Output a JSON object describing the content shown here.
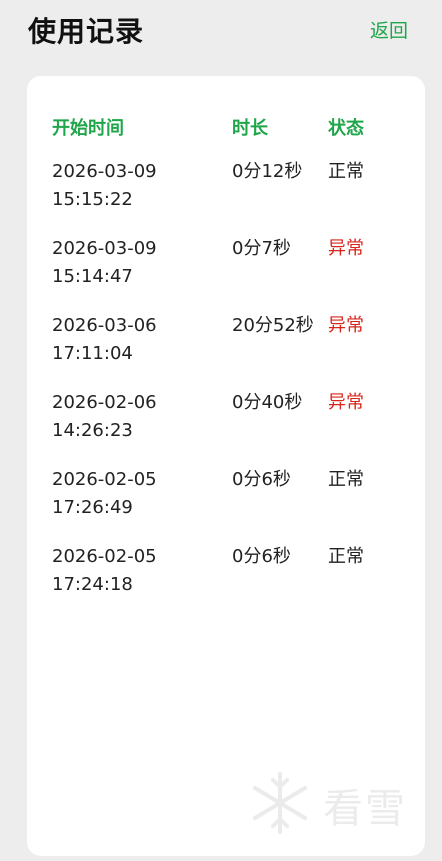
{
  "header": {
    "title": "使用记录",
    "back_label": "返回"
  },
  "colors": {
    "accent": "#1fa64a",
    "abnormal": "#d9261c",
    "normal": "#222222"
  },
  "table": {
    "columns": [
      "开始时间",
      "时长",
      "状态"
    ],
    "rows": [
      {
        "date": "2026-03-09",
        "time": "15:15:22",
        "duration": "0分12秒",
        "status": "正常",
        "abnormal": false
      },
      {
        "date": "2026-03-09",
        "time": "15:14:47",
        "duration": "0分7秒",
        "status": "异常",
        "abnormal": true
      },
      {
        "date": "2026-03-06",
        "time": "17:11:04",
        "duration": "20分52秒",
        "status": "异常",
        "abnormal": true
      },
      {
        "date": "2026-02-06",
        "time": "14:26:23",
        "duration": "0分40秒",
        "status": "异常",
        "abnormal": true
      },
      {
        "date": "2026-02-05",
        "time": "17:26:49",
        "duration": "0分6秒",
        "status": "正常",
        "abnormal": false
      },
      {
        "date": "2026-02-05",
        "time": "17:24:18",
        "duration": "0分6秒",
        "status": "正常",
        "abnormal": false
      }
    ]
  },
  "watermark": {
    "icon": "snowflake-icon",
    "text": "看雪"
  }
}
